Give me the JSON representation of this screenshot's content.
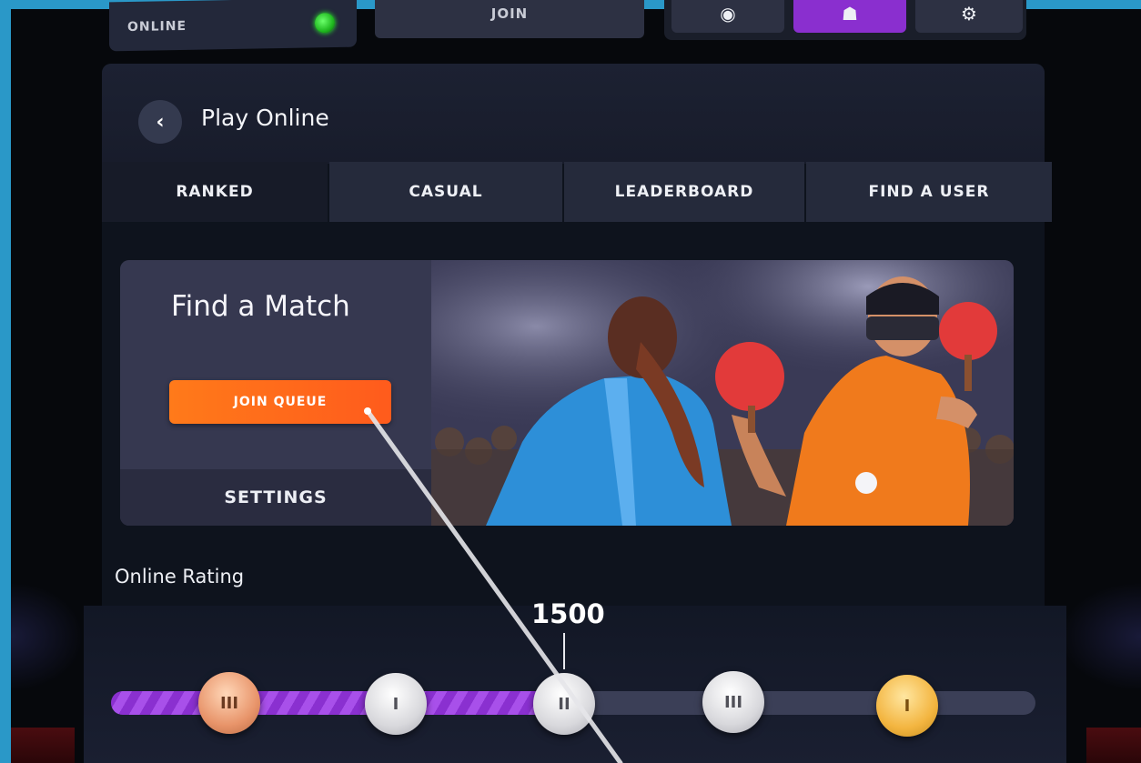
{
  "top_bar": {
    "status_label": "ONLINE",
    "status_color": "#2cff2c",
    "join_label": "JOIN",
    "nav_icons": [
      "globe-icon",
      "leaderboard-icon",
      "settings-gear-icon"
    ],
    "active_nav_color": "#8a2fcf"
  },
  "panel": {
    "back_icon": "‹",
    "title": "Play Online",
    "tabs": [
      {
        "label": "RANKED"
      },
      {
        "label": "CASUAL"
      },
      {
        "label": "LEADERBOARD"
      },
      {
        "label": "FIND A USER"
      }
    ],
    "active_tab": "RANKED"
  },
  "match": {
    "title": "Find a Match",
    "join_queue_label": "JOIN QUEUE",
    "settings_label": "SETTINGS",
    "accent_color": "#ff6a1a"
  },
  "rating": {
    "title": "Online Rating",
    "value": "1500",
    "progress": 0.49,
    "medals": [
      {
        "tier": "bronze",
        "label": "III"
      },
      {
        "tier": "silver",
        "label": "I"
      },
      {
        "tier": "silver",
        "label": "II"
      },
      {
        "tier": "silver",
        "label": "III"
      },
      {
        "tier": "gold",
        "label": "I"
      }
    ]
  }
}
